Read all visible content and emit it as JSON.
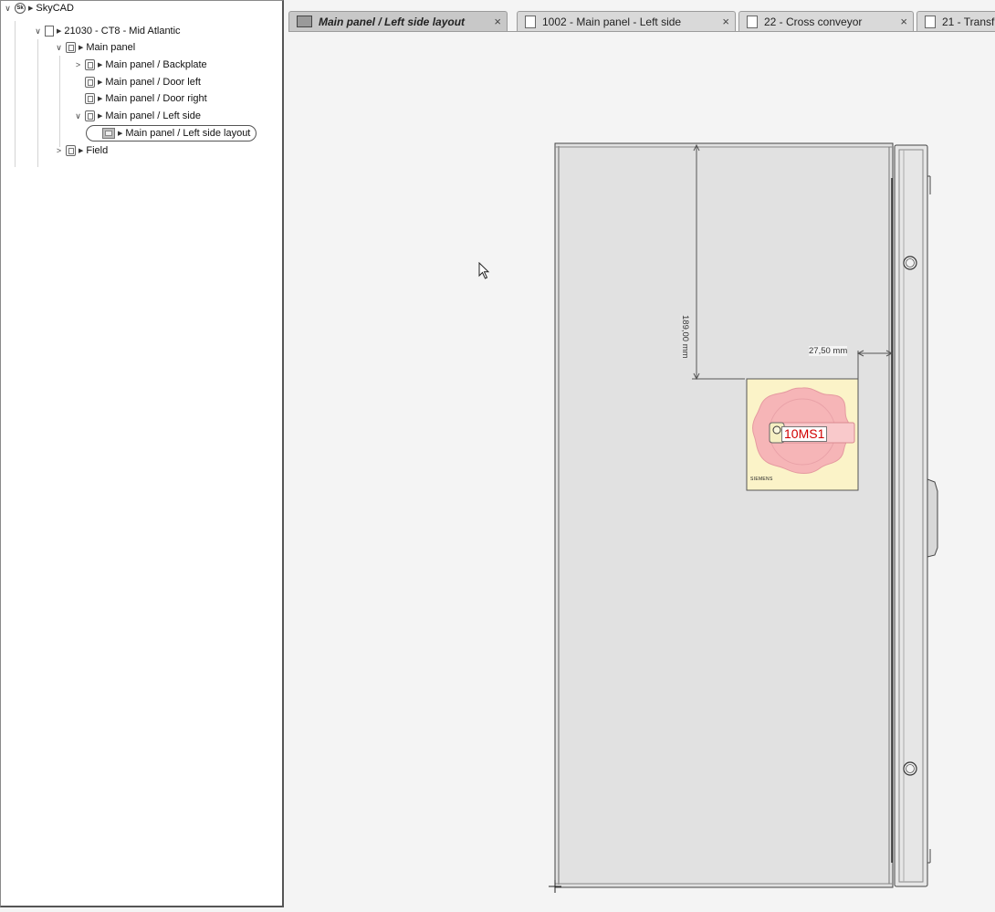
{
  "tree": {
    "nodes": [
      {
        "label": "SkyCAD",
        "icon": "skycad-logo-icon",
        "expanded": true
      },
      {
        "label": "21030 - CT8 - Mid Atlantic",
        "icon": "project-icon",
        "expanded": true
      },
      {
        "label": "Main panel",
        "icon": "cabinet-icon",
        "expanded": true
      },
      {
        "label": "Main panel / Backplate",
        "icon": "cabinet-icon",
        "expanded": false
      },
      {
        "label": "Main panel / Door left",
        "icon": "cabinet-icon"
      },
      {
        "label": "Main panel / Door right",
        "icon": "cabinet-icon"
      },
      {
        "label": "Main panel / Left side",
        "icon": "cabinet-icon",
        "expanded": true
      },
      {
        "label": "Main panel / Left side layout",
        "icon": "layout-icon",
        "selected": true
      },
      {
        "label": "Field",
        "icon": "cabinet-icon",
        "expanded": false
      }
    ]
  },
  "tabs": [
    {
      "label": "Main panel / Left side layout",
      "active": true,
      "close": "×"
    },
    {
      "label": "1002 - Main panel - Left side",
      "active": false,
      "close": "×"
    },
    {
      "label": "22 - Cross conveyor",
      "active": false,
      "close": "×"
    },
    {
      "label": "21 - Transf",
      "active": false,
      "close": ""
    }
  ],
  "drawing": {
    "dimension_vertical": "189,00 mm",
    "dimension_horizontal": "27,50 mm",
    "switch_tag": "10MS1",
    "switch_brand": "SIEMENS"
  },
  "colors": {
    "switch_plate": "#fbf3c8",
    "switch_knob": "#f6b5b7",
    "switch_tag_text": "#d10000",
    "panel_face": "#e1e1e1"
  }
}
